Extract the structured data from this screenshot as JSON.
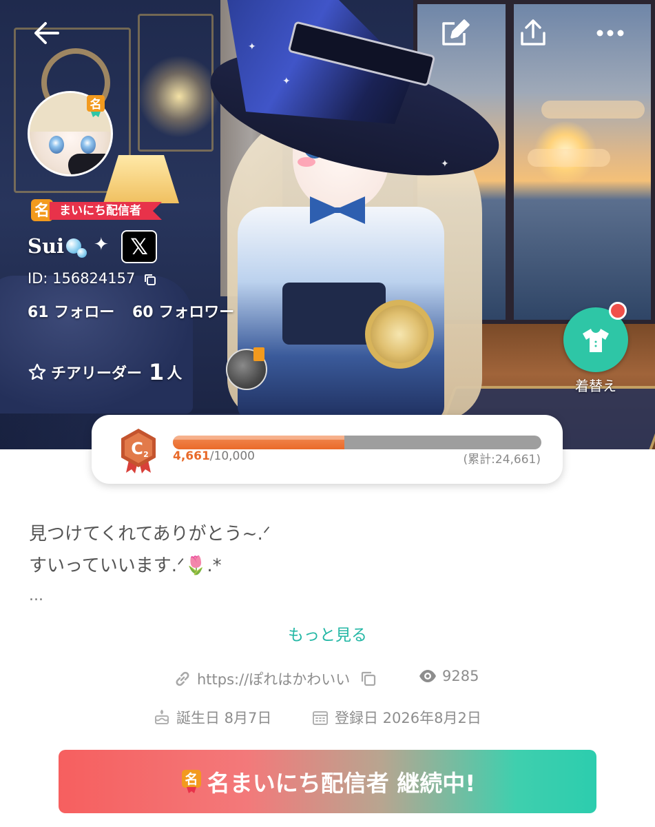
{
  "header": {
    "back": "back-arrow-icon",
    "edit": "edit-icon",
    "share": "share-icon",
    "more": "more-dots-icon"
  },
  "profile": {
    "avatar_badge": "名",
    "daily_badge_icon": "名",
    "daily_badge_label": "まいにち配信者",
    "username": "Sui",
    "x_label": "𝕏",
    "id_text": "ID: 156824157",
    "follow_text": "61 フォロー",
    "follower_text": "60 フォロワー",
    "cheer_label": "チアリーダー",
    "cheer_count": "1",
    "cheer_unit": "人"
  },
  "dressup": {
    "label": "着替え",
    "notification": true
  },
  "level": {
    "rank": "C",
    "rank_sub": "2",
    "current": "4,661",
    "max": "/10,000",
    "progress": 0.4661,
    "total": "(累計:24,661)"
  },
  "bio": {
    "line1": "見つけてくれてありがとう~.ᐟ",
    "line2": "すいっていいます.ᐟ🌷.*",
    "ellipsis": "...",
    "more_label": "もっと見る"
  },
  "meta": {
    "link": "https://ぽれはかわいい",
    "views": "9285",
    "birthday": "誕生日 8月7日",
    "registered": "登録日 2026年8月2日"
  },
  "cta": {
    "icon": "名",
    "label": "名まいにち配信者 継続中!"
  },
  "colors": {
    "accent_teal": "#2ec6a6",
    "accent_red": "#e8324a",
    "level_orange": "#ea6a2a"
  }
}
